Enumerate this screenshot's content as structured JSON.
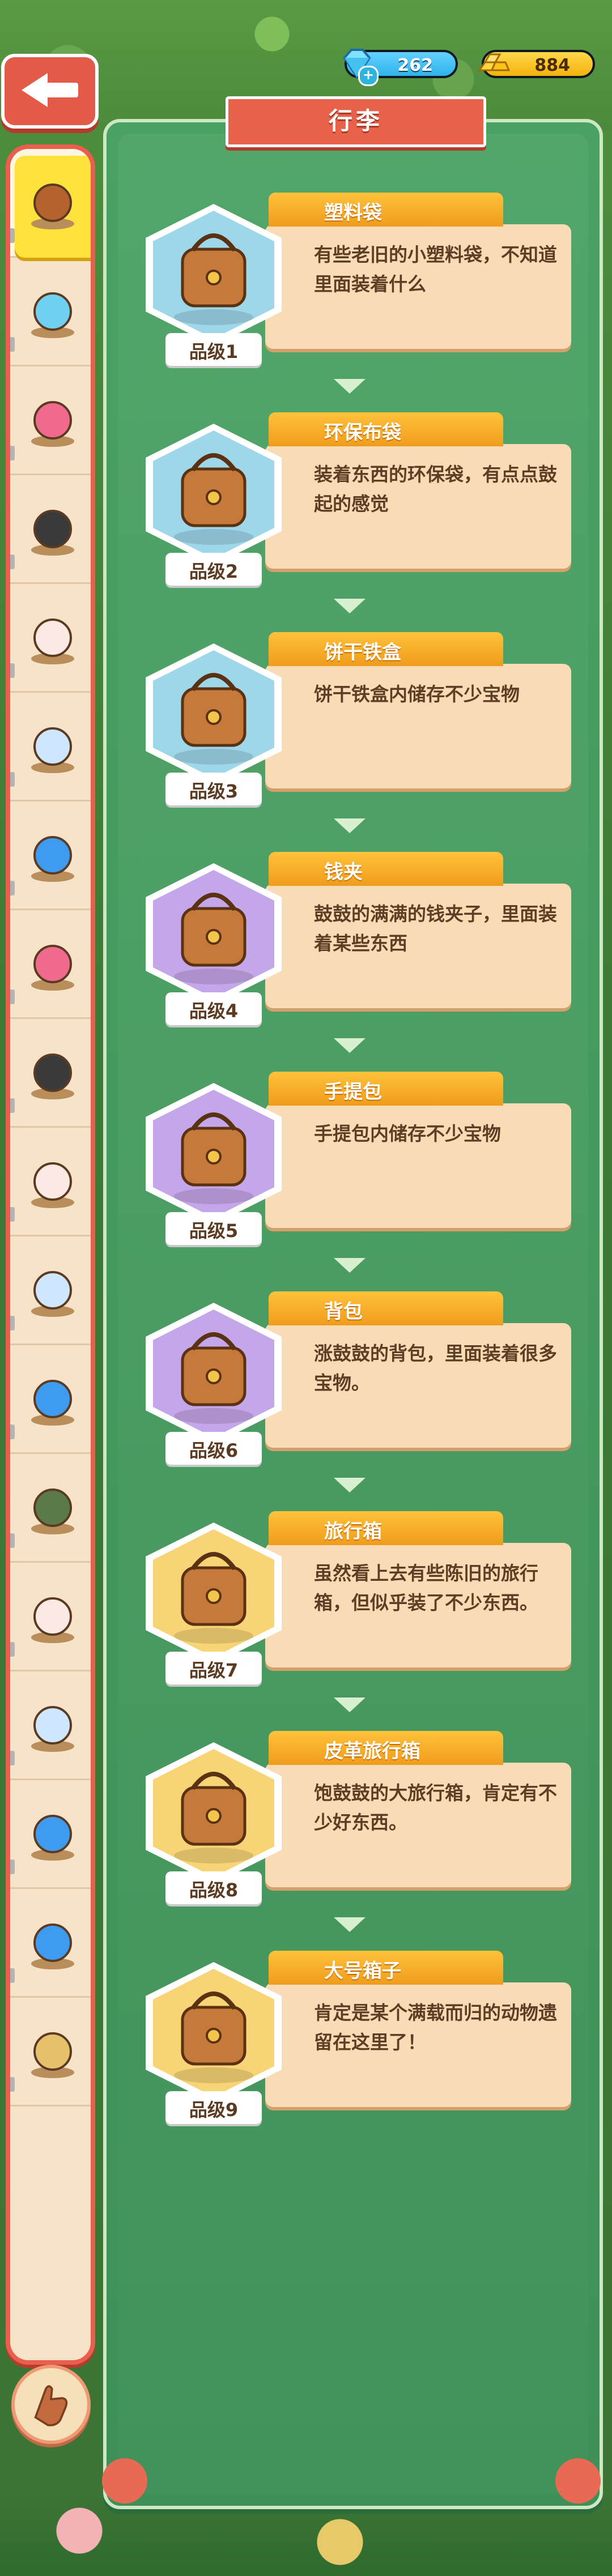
{
  "hud": {
    "gems": "262",
    "gold": "884"
  },
  "panel": {
    "title": "行李"
  },
  "items": [
    {
      "name": "塑料袋",
      "desc": "有些老旧的小塑料袋，不知道里面装着什么",
      "level": "品级1",
      "icon": "plastic-bag-icon",
      "hex_color": "#9fd7ea"
    },
    {
      "name": "环保布袋",
      "desc": "装着东西的环保袋，有点点鼓起的感觉",
      "level": "品级2",
      "icon": "tote-bag-icon",
      "hex_color": "#9fd7ea"
    },
    {
      "name": "饼干铁盒",
      "desc": "饼干铁盒内储存不少宝物",
      "level": "品级3",
      "icon": "cookie-tin-icon",
      "hex_color": "#9fd7ea"
    },
    {
      "name": "钱夹",
      "desc": "鼓鼓的满满的钱夹子，里面装着某些东西",
      "level": "品级4",
      "icon": "coin-purse-icon",
      "hex_color": "#c4a6ea"
    },
    {
      "name": "手提包",
      "desc": "手提包内储存不少宝物",
      "level": "品级5",
      "icon": "handbag-icon",
      "hex_color": "#c4a6ea"
    },
    {
      "name": "背包",
      "desc": "涨鼓鼓的背包，里面装着很多宝物。",
      "level": "品级6",
      "icon": "backpack-icon",
      "hex_color": "#c4a6ea"
    },
    {
      "name": "旅行箱",
      "desc": "虽然看上去有些陈旧的旅行箱，但似乎装了不少东西。",
      "level": "品级7",
      "icon": "suitcase-icon",
      "hex_color": "#f7d476"
    },
    {
      "name": "皮革旅行箱",
      "desc": "饱鼓鼓的大旅行箱，肯定有不少好东西。",
      "level": "品级8",
      "icon": "leather-trunk-icon",
      "hex_color": "#f7d476"
    },
    {
      "name": "大号箱子",
      "desc": "肯定是某个满载而归的动物遗留在这里了！",
      "level": "品级9",
      "icon": "big-box-icon",
      "hex_color": "#f7d476"
    }
  ],
  "sidebar": [
    {
      "icon": "bag-icon",
      "active": true
    },
    {
      "icon": "blue-star-icon"
    },
    {
      "icon": "pink-star-icon"
    },
    {
      "icon": "cauldron-icon"
    },
    {
      "icon": "cat-figure-icon"
    },
    {
      "icon": "snow-globe-icon"
    },
    {
      "icon": "gift-box-icon"
    },
    {
      "icon": "pink-star-icon"
    },
    {
      "icon": "cauldron-icon"
    },
    {
      "icon": "cat-figure-icon"
    },
    {
      "icon": "snow-globe-icon"
    },
    {
      "icon": "gift-box-icon"
    },
    {
      "icon": "small-leaf-icon"
    },
    {
      "icon": "cat-figure-icon"
    },
    {
      "icon": "snow-globe-icon"
    },
    {
      "icon": "gift-box-icon"
    },
    {
      "icon": "gift-box-icon"
    },
    {
      "icon": "partial-icon"
    }
  ],
  "colors": {
    "panel": "#45995c",
    "accent_red": "#e76249",
    "tab_orange": "#f5a623",
    "desc_bg": "#f9dcb5"
  }
}
